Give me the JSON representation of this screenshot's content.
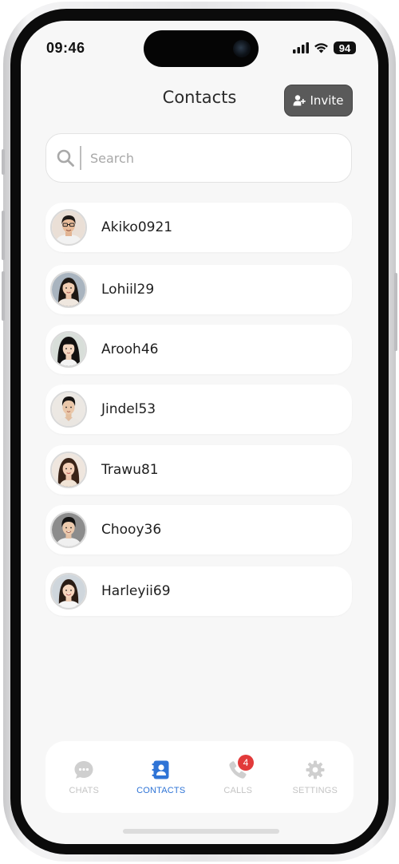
{
  "status_bar": {
    "time": "09:46",
    "battery": "94",
    "icons": [
      "signal-icon",
      "wifi-icon",
      "battery-icon"
    ]
  },
  "header": {
    "title": "Contacts",
    "invite_label": "Invite",
    "invite_icon": "add-person-icon"
  },
  "search": {
    "placeholder": "Search",
    "value": "",
    "icon": "search-icon"
  },
  "contacts": [
    {
      "name": "Akiko0921"
    },
    {
      "name": "Lohiil29"
    },
    {
      "name": "Arooh46"
    },
    {
      "name": "Jindel53"
    },
    {
      "name": "Trawu81"
    },
    {
      "name": "Chooy36"
    },
    {
      "name": "Harleyii69"
    }
  ],
  "tabs": [
    {
      "label": "CHATS",
      "icon": "chat-bubble-icon"
    },
    {
      "label": "CONTACTS",
      "icon": "contact-book-icon",
      "active": true
    },
    {
      "label": "CALLS",
      "icon": "phone-icon",
      "badge": "4"
    },
    {
      "label": "SETTINGS",
      "icon": "gear-icon"
    }
  ],
  "colors": {
    "accent": "#2f74d6",
    "badge": "#e23a3a",
    "invite_bg": "#5a5a5a",
    "background": "#f7f7f7"
  }
}
